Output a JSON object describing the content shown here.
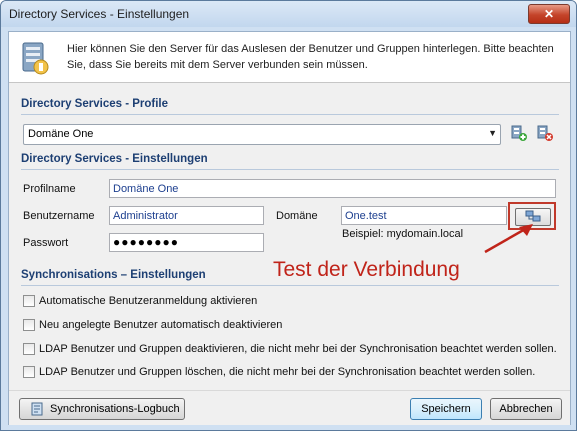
{
  "window": {
    "title": "Directory Services - Einstellungen",
    "close_symbol": "✕"
  },
  "info": {
    "text": "Hier können Sie den Server für das Auslesen der Benutzer und Gruppen hinterlegen. Bitte beachten Sie, dass Sie bereits mit dem Server verbunden sein müssen."
  },
  "profile_section": {
    "title": "Directory Services - Profile",
    "selected_profile": "Domäne One"
  },
  "settings_section": {
    "title": "Directory Services - Einstellungen",
    "profile_name_label": "Profilname",
    "profile_name_value": "Domäne One",
    "username_label": "Benutzername",
    "username_value": "Administrator",
    "domain_label": "Domäne",
    "domain_value": "One.test",
    "password_label": "Passwort",
    "password_value": "●●●●●●●●",
    "example_text": "Beispiel: mydomain.local"
  },
  "annotation": {
    "text": "Test der Verbindung",
    "color": "#c0241a"
  },
  "sync_section": {
    "title": "Synchronisations – Einstellungen",
    "options": [
      {
        "label": "Automatische Benutzeranmeldung aktivieren",
        "checked": false
      },
      {
        "label": "Neu angelegte Benutzer automatisch deaktivieren",
        "checked": false
      },
      {
        "label": "LDAP Benutzer und Gruppen deaktivieren, die nicht mehr bei der Synchronisation beachtet werden sollen.",
        "checked": false
      },
      {
        "label": "LDAP Benutzer und Gruppen löschen, die nicht mehr bei der Synchronisation beachtet werden sollen.",
        "checked": false
      }
    ]
  },
  "footer": {
    "log_button": "Synchronisations-Logbuch",
    "save_button": "Speichern",
    "cancel_button": "Abbrechen"
  },
  "icons": {
    "info": "server-icon",
    "add_profile": "add-server-icon",
    "delete_profile": "delete-server-icon",
    "test_connection": "network-connection-icon",
    "log": "logbook-icon"
  }
}
